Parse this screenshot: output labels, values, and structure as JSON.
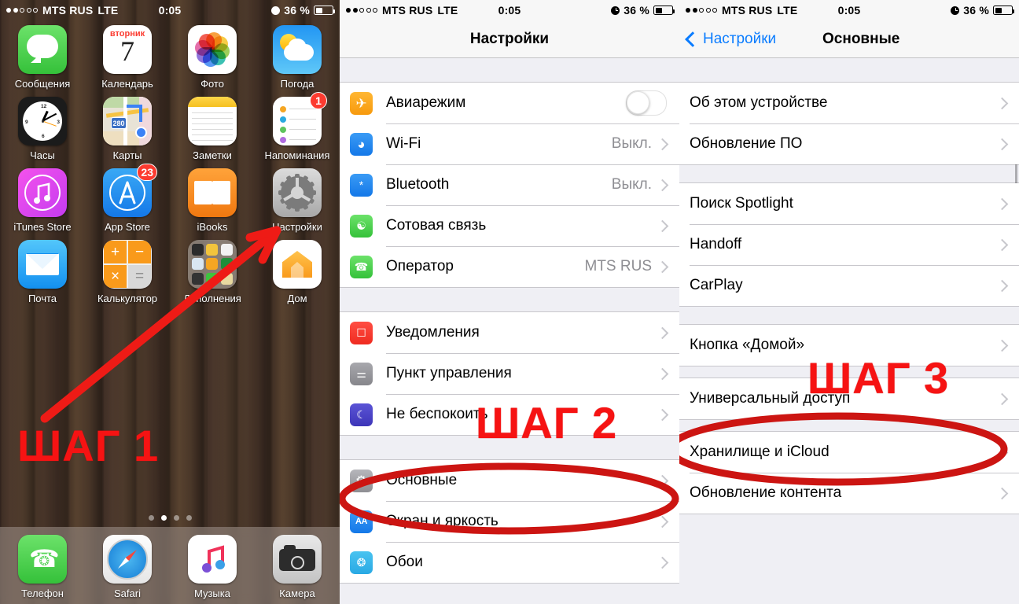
{
  "status_bar": {
    "carrier": "MTS RUS",
    "network": "LTE",
    "time": "0:05",
    "battery": "36 %",
    "signal_filled": 2,
    "signal_total": 5,
    "battery_level_pct": 36,
    "alarm_icon": "alarm-icon"
  },
  "home_screen": {
    "rows": [
      [
        {
          "label": "Сообщения",
          "icon": "messages-icon"
        },
        {
          "label": "Календарь",
          "icon": "calendar-icon",
          "day_name": "вторник",
          "day_number": "7"
        },
        {
          "label": "Фото",
          "icon": "photos-icon"
        },
        {
          "label": "Погода",
          "icon": "weather-icon"
        }
      ],
      [
        {
          "label": "Часы",
          "icon": "clock-icon"
        },
        {
          "label": "Карты",
          "icon": "maps-icon",
          "route_shield": "280"
        },
        {
          "label": "Заметки",
          "icon": "notes-icon"
        },
        {
          "label": "Напоминания",
          "icon": "reminders-icon",
          "badge": "1"
        }
      ],
      [
        {
          "label": "iTunes Store",
          "icon": "itunes-store-icon"
        },
        {
          "label": "App Store",
          "icon": "app-store-icon",
          "badge": "23"
        },
        {
          "label": "iBooks",
          "icon": "ibooks-icon"
        },
        {
          "label": "Настройки",
          "icon": "settings-icon"
        }
      ],
      [
        {
          "label": "Почта",
          "icon": "mail-icon"
        },
        {
          "label": "Калькулятор",
          "icon": "calculator-icon"
        },
        {
          "label": "Дополнения",
          "icon": "folder-icon"
        },
        {
          "label": "Дом",
          "icon": "home-app-icon"
        }
      ]
    ],
    "page_dots": {
      "count": 4,
      "active_index": 1
    },
    "dock": [
      {
        "label": "Телефон",
        "icon": "phone-icon"
      },
      {
        "label": "Safari",
        "icon": "safari-icon"
      },
      {
        "label": "Музыка",
        "icon": "music-icon"
      },
      {
        "label": "Камера",
        "icon": "camera-icon"
      }
    ]
  },
  "settings_panel": {
    "title": "Настройки",
    "groups": [
      {
        "rows": [
          {
            "title": "Авиарежим",
            "icon": "airplane-icon",
            "control": "toggle",
            "toggle_on": false
          },
          {
            "title": "Wi-Fi",
            "icon": "wifi-icon",
            "value": "Выкл.",
            "control": "chevron"
          },
          {
            "title": "Bluetooth",
            "icon": "bluetooth-icon",
            "value": "Выкл.",
            "control": "chevron"
          },
          {
            "title": "Сотовая связь",
            "icon": "cellular-icon",
            "value": "",
            "control": "chevron"
          },
          {
            "title": "Оператор",
            "icon": "carrier-icon",
            "value": "MTS RUS",
            "control": "chevron"
          }
        ]
      },
      {
        "rows": [
          {
            "title": "Уведомления",
            "icon": "notifications-icon",
            "value": "",
            "control": "chevron"
          },
          {
            "title": "Пункт управления",
            "icon": "control-center-icon",
            "value": "",
            "control": "chevron"
          },
          {
            "title": "Не беспокоить",
            "icon": "do-not-disturb-icon",
            "value": "",
            "control": "chevron"
          }
        ]
      },
      {
        "rows": [
          {
            "title": "Основные",
            "icon": "general-icon",
            "value": "",
            "control": "chevron",
            "highlighted": true
          },
          {
            "title": "Экран и яркость",
            "icon": "display-brightness-icon",
            "value": "",
            "control": "chevron"
          },
          {
            "title": "Обои",
            "icon": "wallpaper-icon",
            "value": "",
            "control": "chevron"
          }
        ]
      }
    ]
  },
  "general_panel": {
    "back_label": "Настройки",
    "title": "Основные",
    "groups": [
      {
        "rows": [
          {
            "title": "Об этом устройстве",
            "control": "chevron"
          },
          {
            "title": "Обновление ПО",
            "control": "chevron"
          }
        ]
      },
      {
        "rows": [
          {
            "title": "Поиск Spotlight",
            "control": "chevron"
          },
          {
            "title": "Handoff",
            "control": "chevron"
          },
          {
            "title": "CarPlay",
            "control": "chevron"
          }
        ]
      },
      {
        "rows": [
          {
            "title": "Кнопка «Домой»",
            "control": "chevron"
          }
        ]
      },
      {
        "rows": [
          {
            "title": "Универсальный доступ",
            "control": "chevron",
            "highlighted": true
          }
        ]
      },
      {
        "rows": [
          {
            "title": "Хранилище и iCloud",
            "control": "chevron"
          },
          {
            "title": "Обновление контента",
            "control": "chevron"
          }
        ]
      }
    ]
  },
  "annotations": {
    "color": "#f61313",
    "step1": "ШАГ 1",
    "step2": "ШАГ 2",
    "step3": "ШАГ 3",
    "arrow_name": "red-arrow-to-settings",
    "ellipse1_target": "Основные",
    "ellipse2_target": "Универсальный доступ"
  }
}
